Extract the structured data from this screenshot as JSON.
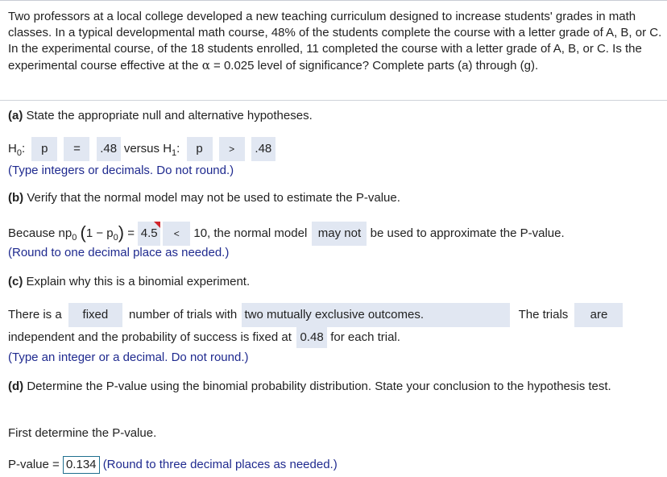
{
  "problem": {
    "intro": "Two professors at a local college developed a new teaching curriculum designed to increase students' grades in math classes. In a typical developmental math course, 48% of the students complete the course with a letter grade of A, B, or C. In the experimental course, of the 18 students enrolled, 11 completed the course with a letter grade of A, B, or C. Is the experimental course effective at the ",
    "alpha_symbol": "α",
    "alpha_value": " = 0.025",
    "intro_end": " level of significance? Complete parts (a) through (g)."
  },
  "part_a": {
    "label": "(a)",
    "question": " State the appropriate null and alternative hypotheses.",
    "h0_label": "H",
    "h0_sub": "0",
    "colon": ":",
    "h0_param": "p",
    "h0_op": "=",
    "h0_value": ".48",
    "versus": "versus",
    "h1_label": "H",
    "h1_sub": "1",
    "h1_param": "p",
    "h1_op": ">",
    "h1_value": ".48",
    "hint": "(Type integers or decimals. Do not round.)"
  },
  "part_b": {
    "label": "(b)",
    "question": " Verify that the normal model may not be used to estimate the P-value.",
    "because": "Because np",
    "sub0": "0",
    "one_minus": "1 − p",
    "sub0b": "0",
    "equals": "=",
    "value": "4.5",
    "comparison": "<",
    "ten_text": "10, the normal model",
    "may_not": "may not",
    "end_text": "be used to approximate the P-value.",
    "hint": "(Round to one decimal place as needed.)"
  },
  "part_c": {
    "label": "(c)",
    "question": " Explain why this is a binomial experiment.",
    "there_is_a": "There is a",
    "fixed": "fixed",
    "number_of_trials": "number of trials with",
    "outcomes": "two mutually exclusive outcomes.",
    "the_trials": "The trials",
    "are": "are",
    "independent_text": "independent and the probability of success is fixed at",
    "probability": "0.48",
    "each_trial": "for each trial.",
    "hint": "(Type an integer or a decimal. Do not round.)"
  },
  "part_d": {
    "label": "(d)",
    "question": " Determine the P-value using the binomial probability distribution. State your conclusion to the hypothesis test.",
    "first_determine": "First determine the P-value.",
    "pvalue_label": "P-value =",
    "pvalue": "0.134",
    "hint": "(Round to three decimal places as needed.)"
  },
  "colors": {
    "hint": "#1f2a8f",
    "answer_box_bg": "#e1e7f2",
    "flag": "#d0242a",
    "active_border": "#1f6f8f"
  }
}
